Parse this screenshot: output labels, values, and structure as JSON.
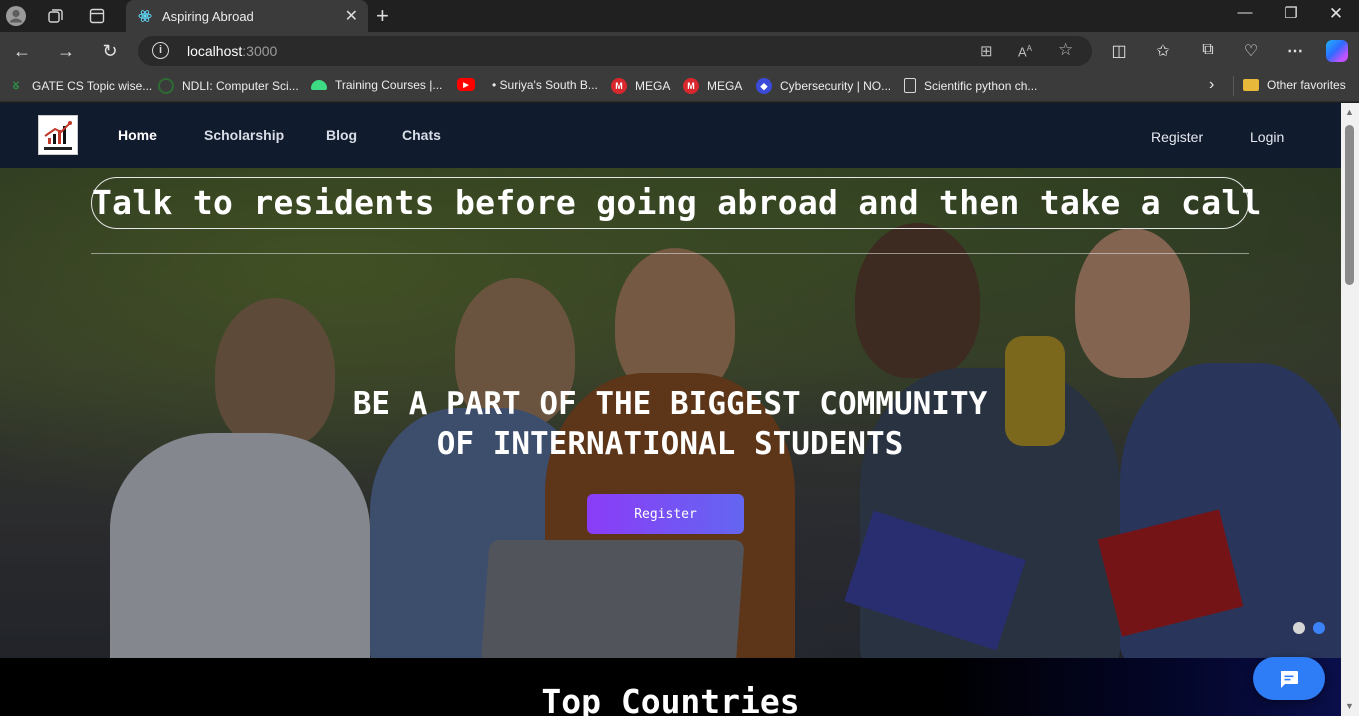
{
  "browser": {
    "tab_title": "Aspiring Abroad",
    "url_host": "localhost",
    "url_port": ":3000",
    "bookmarks": [
      {
        "label": "GATE CS Topic wise...",
        "icon": "gfg-icon"
      },
      {
        "label": "NDLI: Computer Sci...",
        "icon": "ndli-icon"
      },
      {
        "label": "Training Courses  |...",
        "icon": "android-icon"
      },
      {
        "label": "",
        "icon": "youtube-icon"
      },
      {
        "label": "• Suriya's South B...",
        "icon": "none"
      },
      {
        "label": "MEGA",
        "icon": "mega-icon"
      },
      {
        "label": "MEGA",
        "icon": "mega-icon"
      },
      {
        "label": "Cybersecurity | NO...",
        "icon": "shield-icon"
      },
      {
        "label": "Scientific python ch...",
        "icon": "page-icon"
      }
    ],
    "other_favorites": "Other favorites"
  },
  "site": {
    "nav": {
      "items": [
        "Home",
        "Scholarship",
        "Blog",
        "Chats"
      ],
      "register": "Register",
      "login": "Login"
    },
    "hero": {
      "tagline": "Talk to residents before going abroad and then take a call",
      "headline_line1": "BE A PART OF THE BIGGEST COMMUNITY",
      "headline_line2": "OF INTERNATIONAL STUDENTS",
      "cta": "Register",
      "carousel_active_index": 1,
      "carousel_count": 2
    },
    "section_title": "Top Countries"
  },
  "colors": {
    "nav_bg": "#111b2e",
    "cta_start": "#8b3cf7",
    "cta_end": "#6366f1",
    "chat_button": "#2f7df6"
  }
}
